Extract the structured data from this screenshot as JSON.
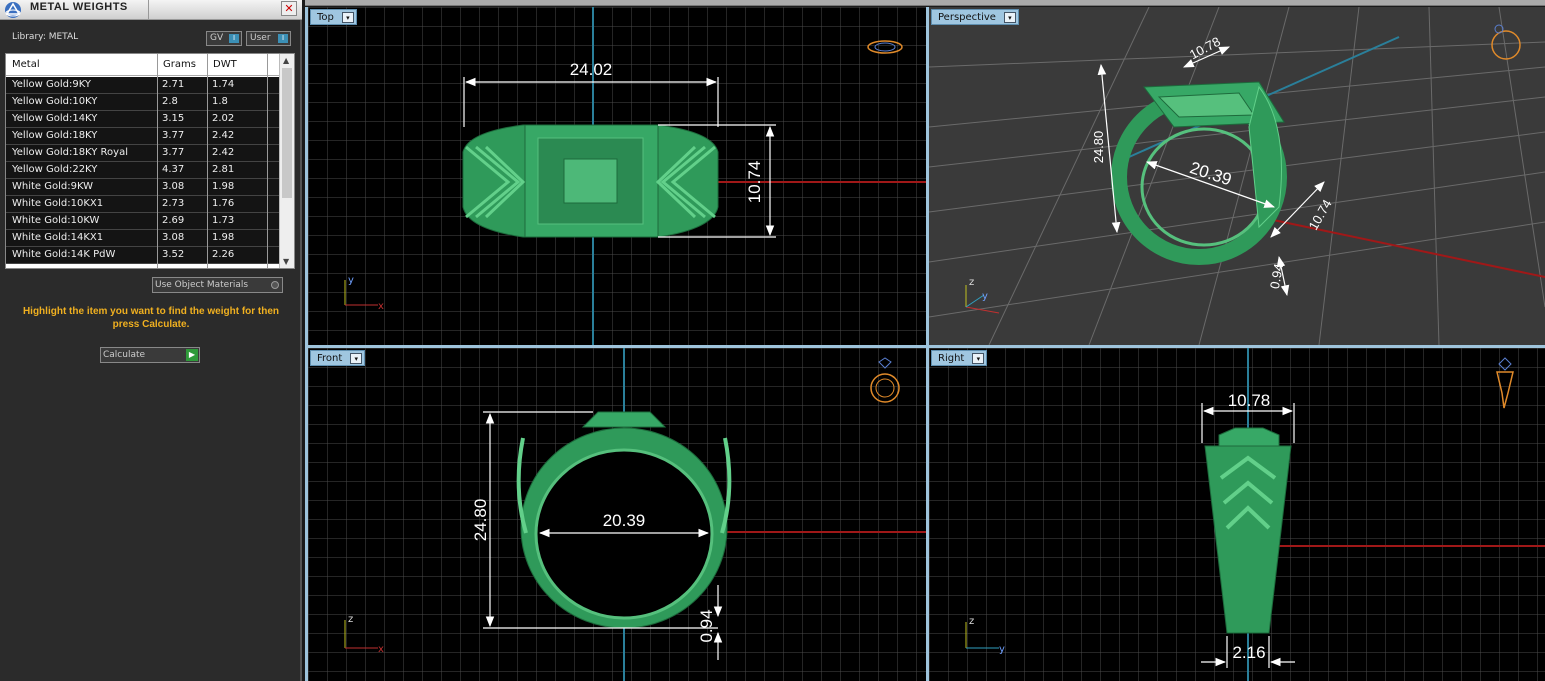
{
  "panel": {
    "title": "METAL WEIGHTS",
    "close_glyph": "✕",
    "library_label": "Library: METAL",
    "chip_gv": "GV",
    "chip_user": "User",
    "toggle_glyph": "I",
    "columns": [
      "Metal",
      "Grams",
      "DWT"
    ],
    "rows": [
      [
        "Yellow Gold:9KY",
        "2.71",
        "1.74"
      ],
      [
        "Yellow Gold:10KY",
        "2.8",
        "1.8"
      ],
      [
        "Yellow Gold:14KY",
        "3.15",
        "2.02"
      ],
      [
        "Yellow Gold:18KY",
        "3.77",
        "2.42"
      ],
      [
        "Yellow Gold:18KY Royal",
        "3.77",
        "2.42"
      ],
      [
        "Yellow Gold:22KY",
        "4.37",
        "2.81"
      ],
      [
        "White Gold:9KW",
        "3.08",
        "1.98"
      ],
      [
        "White Gold:10KX1",
        "2.73",
        "1.76"
      ],
      [
        "White Gold:10KW",
        "2.69",
        "1.73"
      ],
      [
        "White Gold:14KX1",
        "3.08",
        "1.98"
      ],
      [
        "White Gold:14K PdW",
        "3.52",
        "2.26"
      ]
    ],
    "use_object_materials": "Use Object Materials",
    "hint": "Highlight the item you want to find the weight for then press Calculate.",
    "calculate_label": "Calculate",
    "colors": {
      "hint": "#f0b020",
      "accent": "#9fc6e0",
      "model": "#2f9a5a"
    }
  },
  "viewports": {
    "top": {
      "label": "Top",
      "dims": {
        "width": "24.02",
        "height": "10.74"
      },
      "axes": {
        "a": "y",
        "b": "x"
      }
    },
    "perspective": {
      "label": "Perspective",
      "dims": {
        "top": "10.78",
        "height": "24.80",
        "inner": "20.39",
        "side": "10.74",
        "thick": "0.94"
      },
      "axes": {
        "a": "z",
        "b": "y"
      }
    },
    "front": {
      "label": "Front",
      "dims": {
        "height": "24.80",
        "inner": "20.39",
        "thick": "0.94"
      },
      "axes": {
        "a": "z",
        "b": "x"
      }
    },
    "right": {
      "label": "Right",
      "dims": {
        "top": "10.78",
        "bottom": "2.16"
      },
      "axes": {
        "a": "z",
        "b": "y"
      }
    }
  },
  "dropdown_glyph": "▾",
  "scroll_up": "▲",
  "scroll_down": "▼",
  "go_glyph": "▶"
}
